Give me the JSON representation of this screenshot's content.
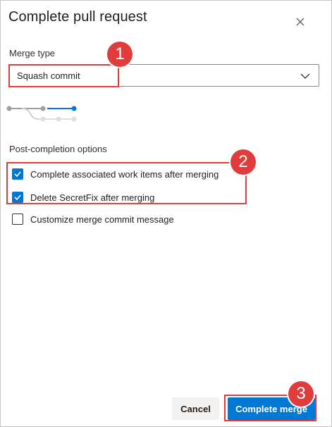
{
  "dialog": {
    "title": "Complete pull request",
    "close_icon": "close-icon"
  },
  "merge_type": {
    "label": "Merge type",
    "selected": "Squash commit",
    "chevron_icon": "chevron-down-icon"
  },
  "post_completion": {
    "label": "Post-completion options",
    "options": [
      {
        "label": "Complete associated work items after merging",
        "checked": true
      },
      {
        "label": "Delete SecretFix after merging",
        "checked": true
      },
      {
        "label": "Customize merge commit message",
        "checked": false
      }
    ]
  },
  "buttons": {
    "cancel": "Cancel",
    "complete": "Complete merge"
  },
  "callouts": [
    "1",
    "2",
    "3"
  ],
  "colors": {
    "accent": "#0078d4",
    "callout": "#e03c3c"
  }
}
